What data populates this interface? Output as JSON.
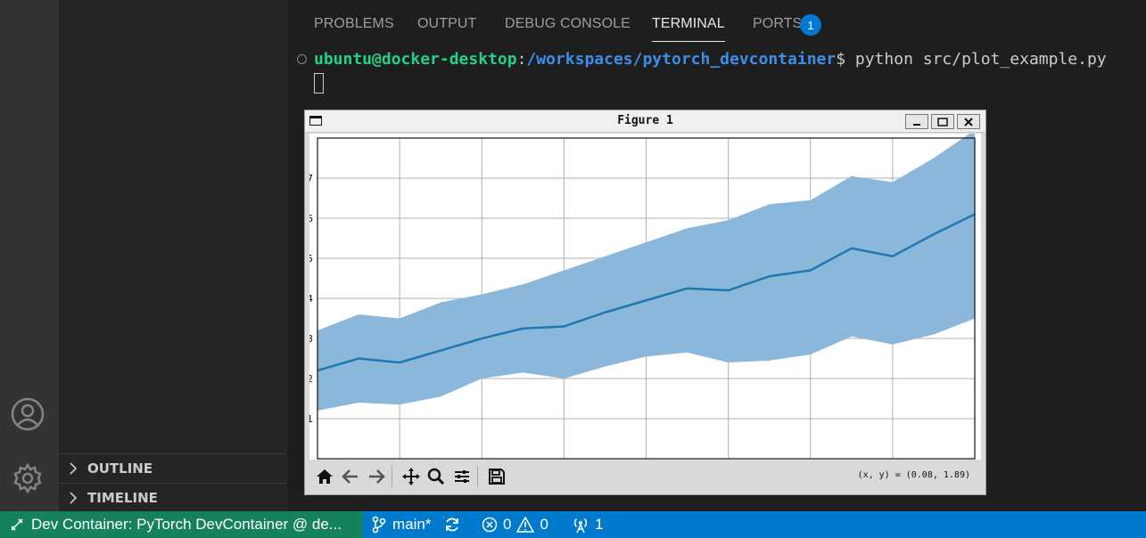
{
  "panel": {
    "tabs": [
      {
        "label": "PROBLEMS"
      },
      {
        "label": "OUTPUT"
      },
      {
        "label": "DEBUG CONSOLE"
      },
      {
        "label": "TERMINAL"
      },
      {
        "label": "PORTS"
      }
    ],
    "ports_badge": "1",
    "active_tab": "TERMINAL"
  },
  "terminal": {
    "user_host": "ubuntu@docker-desktop",
    "sep": ":",
    "path": "/workspaces/pytorch_devcontainer",
    "prompt": "$",
    "command": " python src/plot_example.py"
  },
  "figure": {
    "window_title": "Figure 1",
    "coords_readout": "(x, y) = (0.08, 1.89)",
    "toolbar": [
      "home-icon",
      "back-icon",
      "forward-icon",
      "pan-icon",
      "zoom-icon",
      "configure-icon",
      "save-icon"
    ]
  },
  "sidebar": {
    "sections": [
      {
        "label": "OUTLINE"
      },
      {
        "label": "TIMELINE"
      }
    ]
  },
  "statusbar": {
    "remote": "Dev Container: PyTorch DevContainer @ de...",
    "branch": "main*",
    "errors": "0",
    "warnings": "0",
    "ports": "1"
  },
  "chart_data": {
    "type": "area",
    "title": "",
    "xlabel": "",
    "ylabel": "",
    "xlim": [
      0,
      8
    ],
    "ylim": [
      0,
      8
    ],
    "yticks_visible_fragments": [
      "7",
      "6",
      "5",
      "4",
      "3",
      "2",
      "1"
    ],
    "x": [
      0,
      0.5,
      1,
      1.5,
      2,
      2.5,
      3,
      3.5,
      4,
      4.5,
      5,
      5.5,
      6,
      6.5,
      7,
      7.5,
      8
    ],
    "series": [
      {
        "values": [
          2.2,
          2.5,
          2.4,
          2.7,
          3.0,
          3.25,
          3.3,
          3.65,
          3.95,
          4.25,
          4.2,
          4.55,
          4.7,
          5.25,
          5.05,
          5.6,
          6.1
        ]
      },
      {
        "upper": [
          3.2,
          3.6,
          3.5,
          3.9,
          4.1,
          4.35,
          4.7,
          5.05,
          5.4,
          5.75,
          5.95,
          6.35,
          6.45,
          7.05,
          6.9,
          7.5,
          8.2
        ],
        "lower": [
          1.2,
          1.4,
          1.35,
          1.55,
          2.0,
          2.15,
          2.0,
          2.3,
          2.55,
          2.65,
          2.4,
          2.45,
          2.6,
          3.05,
          2.85,
          3.1,
          3.5
        ]
      }
    ],
    "colors": {
      "line": "#1f77b4",
      "band": "#8bb8da",
      "grid": "#b0b0b0"
    },
    "grid": true
  }
}
